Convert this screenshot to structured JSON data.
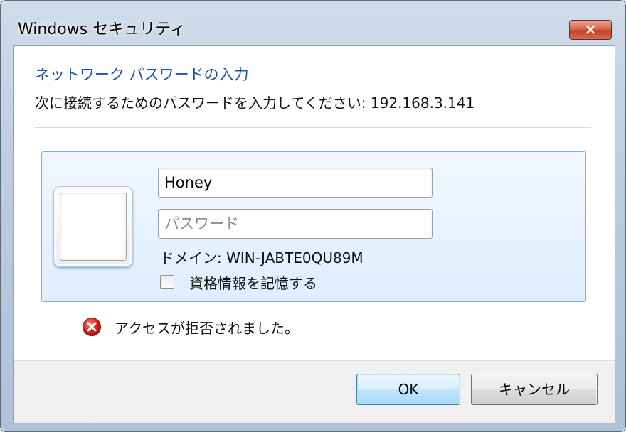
{
  "window": {
    "title": "Windows セキュリティ",
    "close_label": "×"
  },
  "dialog": {
    "heading": "ネットワーク パスワードの入力",
    "instruction": "次に接続するためのパスワードを入力してください: 192.168.3.141"
  },
  "credentials": {
    "username_value": "Honey",
    "password_placeholder": "パスワード",
    "domain_text": "ドメイン: WIN-JABTE0QU89M",
    "remember_label": "資格情報を記憶する",
    "remember_checked": false
  },
  "error": {
    "message": "アクセスが拒否されました。",
    "icon": "error-icon"
  },
  "buttons": {
    "ok_label": "OK",
    "cancel_label": "キャンセル"
  },
  "colors": {
    "heading_blue": "#1e55a0",
    "close_red": "#c2412a",
    "panel_border": "#84ace0"
  }
}
